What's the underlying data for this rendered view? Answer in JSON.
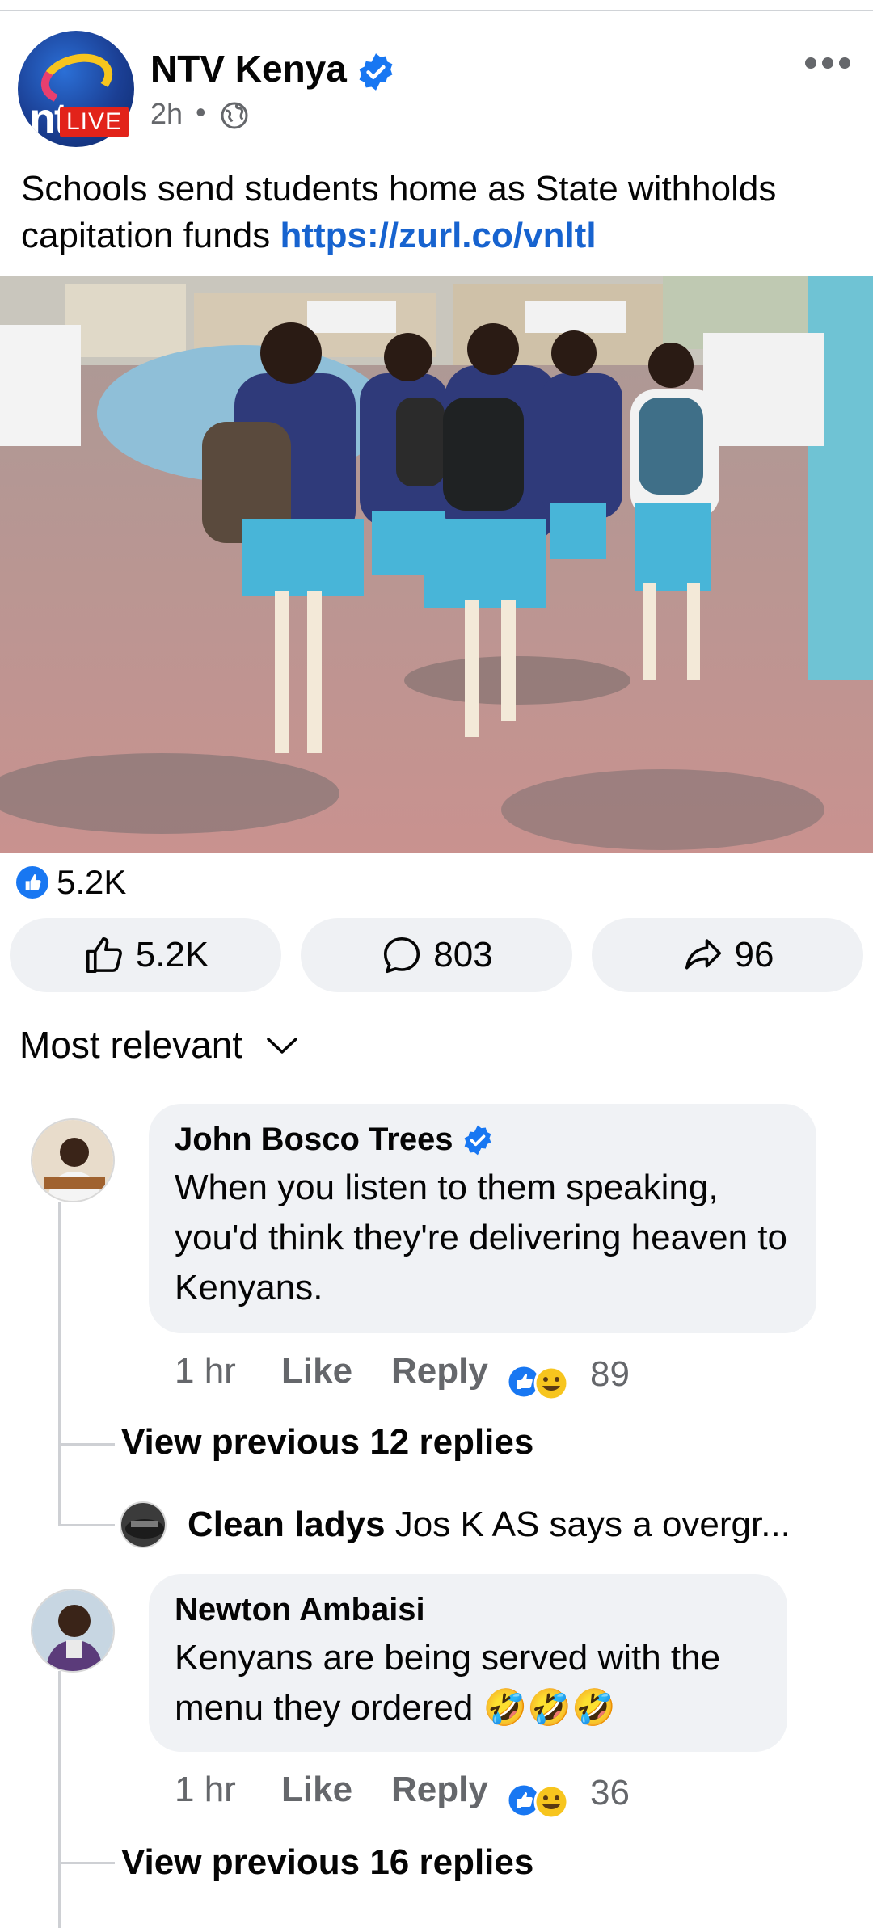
{
  "post": {
    "page_name": "NTV Kenya",
    "live_label": "LIVE",
    "time": "2h",
    "separator": "•",
    "caption_text": "Schools send students home as State withholds capitation funds ",
    "caption_link": "https://zurl.co/vnltl"
  },
  "reactions": {
    "summary_count": "5.2K",
    "like_count": "5.2K",
    "comment_count": "803",
    "share_count": "96"
  },
  "sort_label": "Most relevant",
  "comments": [
    {
      "author": "John Bosco Trees",
      "verified": true,
      "text": "When you listen to them speaking, you'd think they're delivering heaven to Kenyans.",
      "time": "1 hr",
      "like_label": "Like",
      "reply_label": "Reply",
      "reaction_count": "89",
      "view_previous": "View previous 12 replies",
      "latest_reply_author": "Clean ladys",
      "latest_reply_text": "Jos K AS says a overgr..."
    },
    {
      "author": "Newton Ambaisi",
      "verified": false,
      "text": "Kenyans are being served with the menu they ordered 🤣🤣🤣",
      "time": "1 hr",
      "like_label": "Like",
      "reply_label": "Reply",
      "reaction_count": "36",
      "view_previous": "View previous 16 replies"
    }
  ],
  "colors": {
    "link": "#1763cf",
    "pill_bg": "#eff1f4",
    "bubble_bg": "#f0f2f5",
    "meta_text": "#65676b",
    "verified_blue": "#1877f2",
    "live_red": "#e2231a"
  }
}
